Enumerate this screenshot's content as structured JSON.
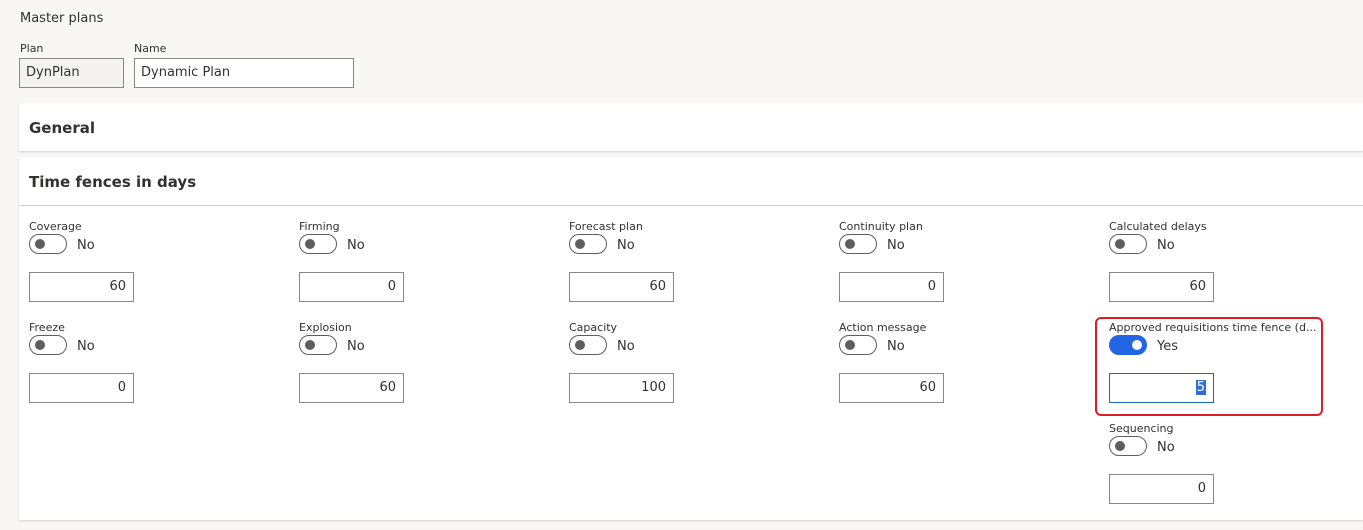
{
  "page": {
    "title": "Master plans"
  },
  "header": {
    "plan_label": "Plan",
    "plan_value": "DynPlan",
    "name_label": "Name",
    "name_value": "Dynamic Plan"
  },
  "general": {
    "title": "General"
  },
  "time_fences": {
    "title": "Time fences in days",
    "fields": [
      {
        "label": "Coverage",
        "toggle": "No",
        "value": "60"
      },
      {
        "label": "Firming",
        "toggle": "No",
        "value": "0"
      },
      {
        "label": "Forecast plan",
        "toggle": "No",
        "value": "60"
      },
      {
        "label": "Continuity plan",
        "toggle": "No",
        "value": "0"
      },
      {
        "label": "Calculated delays",
        "toggle": "No",
        "value": "60"
      },
      {
        "label": "Freeze",
        "toggle": "No",
        "value": "0"
      },
      {
        "label": "Explosion",
        "toggle": "No",
        "value": "60"
      },
      {
        "label": "Capacity",
        "toggle": "No",
        "value": "100"
      },
      {
        "label": "Action message",
        "toggle": "No",
        "value": "60"
      },
      {
        "label": "Approved requisitions time fence (d...",
        "toggle": "Yes",
        "value": "5"
      },
      {
        "label": "Sequencing",
        "toggle": "No",
        "value": "0"
      }
    ]
  },
  "colors": {
    "accent": "#2266e3",
    "highlight": "#e01b24"
  }
}
